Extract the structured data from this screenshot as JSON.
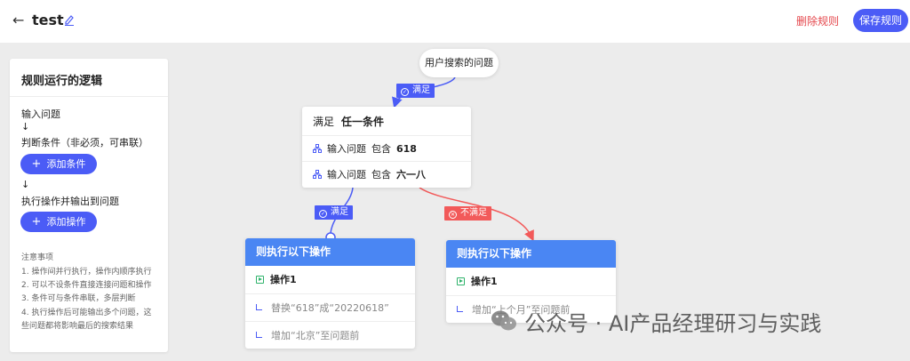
{
  "header": {
    "title": "test",
    "delete_label": "删除规则",
    "save_label": "保存规则"
  },
  "panel": {
    "title": "规则运行的逻辑",
    "step1": "输入问题",
    "arrow": "↓",
    "step2": "判断条件（非必须，可串联）",
    "add_condition": "添加条件",
    "step3": "执行操作并输出到问题",
    "add_action": "添加操作",
    "notes_title": "注意事项",
    "notes": [
      "1. 操作间并行执行，操作内顺序执行",
      "2. 可以不设条件直接连接问题和操作",
      "3. 条件可与条件串联，多层判断",
      "4. 执行操作后可能输出多个问题，这",
      "些问题都将影响最后的搜索结果"
    ]
  },
  "query_node": {
    "label": "用户搜索的问题"
  },
  "edge_labels": {
    "satisfied": "满足",
    "not_satisfied": "不满足"
  },
  "condition_card": {
    "head": "满足",
    "mode": "任一条件",
    "rows": [
      {
        "field": "输入问题",
        "op": "包含",
        "value": "618"
      },
      {
        "field": "输入问题",
        "op": "包含",
        "value": "六一八"
      }
    ]
  },
  "action_card_left": {
    "head": "则执行以下操作",
    "op_title": "操作1",
    "rows": [
      "替换“618”成“20220618”",
      "增加“北京”至问题前"
    ]
  },
  "action_card_right": {
    "head": "则执行以下操作",
    "op_title": "操作1",
    "rows": [
      "增加“上个月”至问题前"
    ]
  },
  "watermark": "公众号 · AI产品经理研习与实践",
  "colors": {
    "primary": "#4b5cf6",
    "danger": "#f25a5a",
    "card_header": "#4a86f3",
    "canvas": "#ececec"
  }
}
